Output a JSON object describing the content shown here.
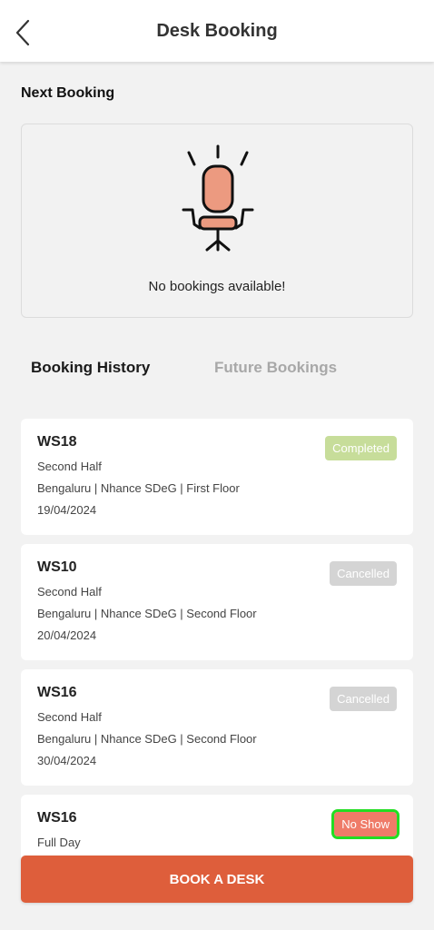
{
  "header": {
    "title": "Desk Booking",
    "back_icon": "chevron-left-icon"
  },
  "next_booking": {
    "title": "Next Booking",
    "empty_icon": "office-chair-icon",
    "empty_text": "No bookings available!"
  },
  "tabs": [
    {
      "label": "Booking History",
      "active": true
    },
    {
      "label": "Future Bookings",
      "active": false
    }
  ],
  "bookings": [
    {
      "desk": "WS18",
      "slot": "Second Half",
      "location": "Bengaluru | Nhance SDeG | First Floor",
      "date": "19/04/2024",
      "status": "Completed"
    },
    {
      "desk": "WS10",
      "slot": "Second Half",
      "location": "Bengaluru | Nhance SDeG | Second Floor",
      "date": "20/04/2024",
      "status": "Cancelled"
    },
    {
      "desk": "WS16",
      "slot": "Second Half",
      "location": "Bengaluru | Nhance SDeG | Second Floor",
      "date": "30/04/2024",
      "status": "Cancelled"
    },
    {
      "desk": "WS16",
      "slot": "Full Day",
      "status": "No Show"
    }
  ],
  "actions": {
    "book_label": "BOOK A DESK"
  },
  "colors": {
    "primary": "#de5e3b",
    "completed": "#c7dd9a",
    "cancelled": "#d4d4d4",
    "no_show": "#ef7b68",
    "chair_accent": "#ec9a80"
  }
}
